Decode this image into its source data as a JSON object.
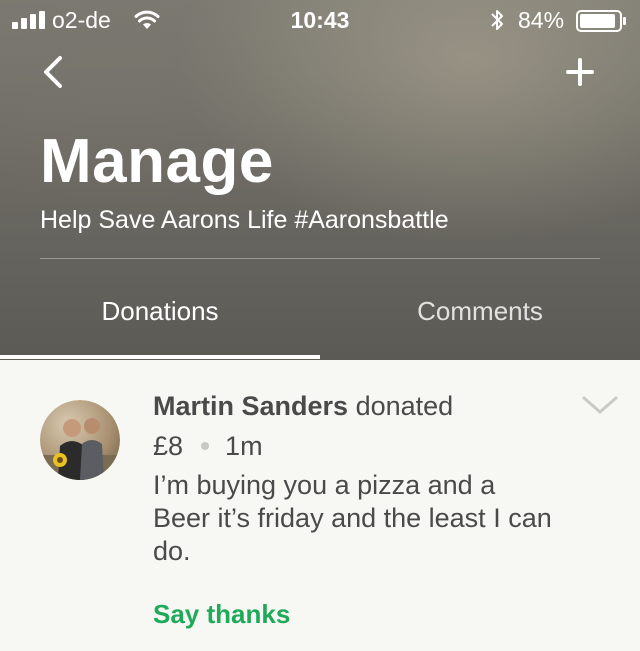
{
  "status_bar": {
    "carrier": "o2-de",
    "time": "10:43",
    "battery_percent": "84%"
  },
  "header": {
    "title": "Manage",
    "subtitle": "Help Save Aarons Life #Aaronsbattle"
  },
  "tabs": [
    {
      "label": "Donations",
      "active": true
    },
    {
      "label": "Comments",
      "active": false
    }
  ],
  "donation": {
    "donor_name": "Martin Sanders",
    "action": "donated",
    "amount": "£8",
    "time_ago": "1m",
    "message": "I’m buying you a pizza  and a Beer  it’s friday and the least I can do.",
    "say_thanks_label": "Say thanks"
  },
  "colors": {
    "accent_green": "#1faa5a",
    "text_dark": "#4a4a4a",
    "card_background": "#f7f7f3"
  },
  "icons": {
    "back": "chevron-left-icon",
    "add": "plus-icon",
    "expand": "chevron-down-icon"
  }
}
